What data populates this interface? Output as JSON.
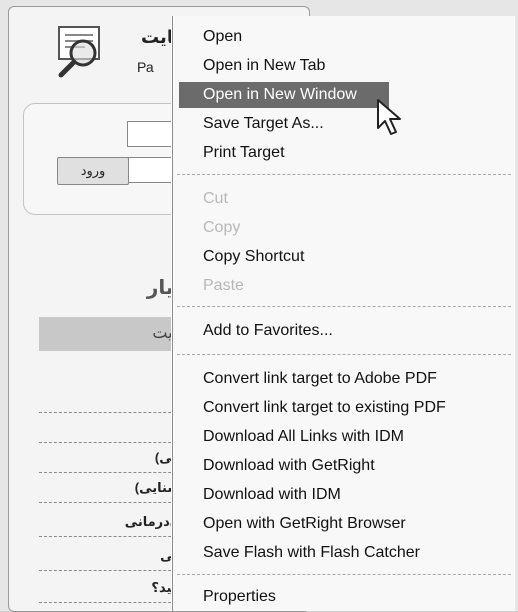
{
  "site": {
    "title": "سایت",
    "subtitle": "Ра",
    "login_button": "ورود",
    "panel_heading": "ت یار",
    "panel_bar": "ن سایت",
    "rows": [
      "ست؟",
      "شما",
      "(اسنایی)",
      "بل (اسنایی)",
      "ا روان‌درمانی",
      "شناسی",
      "می‌دانید؟"
    ]
  },
  "context_menu": {
    "items": [
      {
        "label": "Open",
        "state": "normal"
      },
      {
        "label": "Open in New Tab",
        "state": "normal"
      },
      {
        "label": "Open in New Window",
        "state": "highlighted"
      },
      {
        "label": "Save Target As...",
        "state": "normal"
      },
      {
        "label": "Print Target",
        "state": "normal"
      },
      {
        "label": "Cut",
        "state": "disabled"
      },
      {
        "label": "Copy",
        "state": "disabled"
      },
      {
        "label": "Copy Shortcut",
        "state": "normal"
      },
      {
        "label": "Paste",
        "state": "disabled"
      },
      {
        "label": "Add to Favorites...",
        "state": "normal"
      },
      {
        "label": "Convert link target to Adobe PDF",
        "state": "normal"
      },
      {
        "label": "Convert link target to existing PDF",
        "state": "normal"
      },
      {
        "label": "Download All Links with IDM",
        "state": "normal"
      },
      {
        "label": "Download with GetRight",
        "state": "normal"
      },
      {
        "label": "Download with IDM",
        "state": "normal"
      },
      {
        "label": "Open with GetRight Browser",
        "state": "normal"
      },
      {
        "label": "Save Flash with Flash Catcher",
        "state": "normal"
      },
      {
        "label": "Properties",
        "state": "normal"
      }
    ]
  },
  "icons": {
    "site_logo": "magnifier-document-icon",
    "cursor": "arrow-cursor-icon"
  }
}
